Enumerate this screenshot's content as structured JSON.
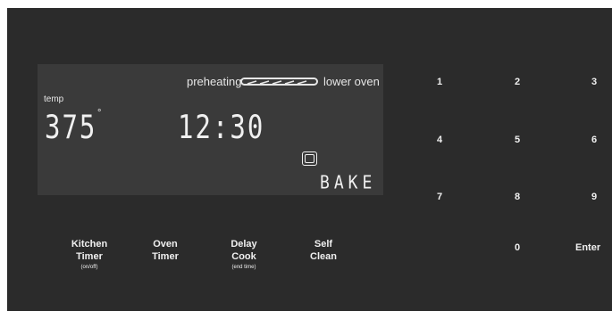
{
  "display": {
    "preheating_label": "preheating",
    "oven_label": "lower oven",
    "temp_label": "temp",
    "temperature": "375",
    "degree_symbol": "°",
    "time": "12:30",
    "mode": "BAKE"
  },
  "function_buttons": {
    "kitchen_timer": {
      "line1": "Kitchen",
      "line2": "Timer",
      "sub": "(on/off)"
    },
    "oven_timer": {
      "line1": "Oven",
      "line2": "Timer"
    },
    "delay_cook": {
      "line1": "Delay",
      "line2": "Cook",
      "sub": "(end time)"
    },
    "self_clean": {
      "line1": "Self",
      "line2": "Clean"
    }
  },
  "keypad": {
    "k1": "1",
    "k2": "2",
    "k3": "3",
    "k4": "4",
    "k5": "5",
    "k6": "6",
    "k7": "7",
    "k8": "8",
    "k9": "9",
    "k0": "0",
    "enter": "Enter"
  },
  "colors": {
    "panel": "#2b2b2b",
    "display": "#3a3a3a",
    "text": "#f0f0f0"
  }
}
